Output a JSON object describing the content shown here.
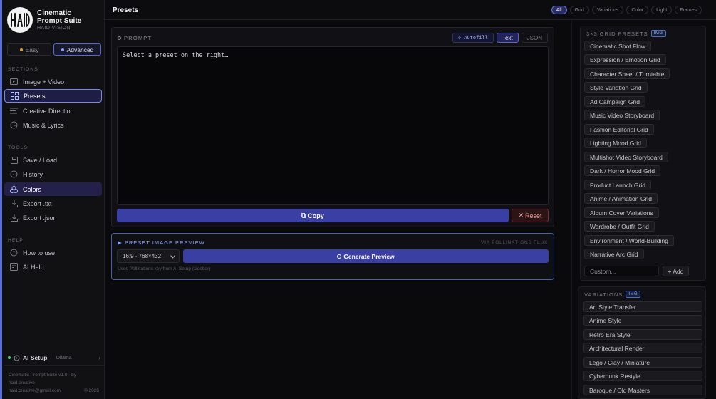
{
  "brand": {
    "title": "Cinematic Prompt Suite",
    "subtitle": "HAID.VISION",
    "logo_text": "HAID"
  },
  "mode": {
    "easy_label": "Easy",
    "advanced_label": "Advanced",
    "selected": "Advanced"
  },
  "sidebar": {
    "sections_label": "SECTIONS",
    "sections": [
      {
        "label": "Image + Video",
        "icon": "image-icon"
      },
      {
        "label": "Presets",
        "icon": "grid-icon"
      },
      {
        "label": "Creative Direction",
        "icon": "lines-icon"
      },
      {
        "label": "Music & Lyrics",
        "icon": "clock-icon"
      }
    ],
    "tools_label": "TOOLS",
    "tools": [
      {
        "label": "Save / Load",
        "icon": "save-icon"
      },
      {
        "label": "History",
        "icon": "history-icon"
      },
      {
        "label": "Colors",
        "icon": "palette-icon"
      },
      {
        "label": "Export .txt",
        "icon": "download-icon"
      },
      {
        "label": "Export .json",
        "icon": "download-icon"
      }
    ],
    "help_label": "HELP",
    "help": [
      {
        "label": "How to use",
        "icon": "question-icon"
      },
      {
        "label": "AI Help",
        "icon": "ai-help-icon"
      }
    ],
    "ai_setup": {
      "label": "AI Setup",
      "provider": "Ollama",
      "chevron": "›"
    },
    "footer": {
      "line1": "Cinematic Prompt Suite v1.0 · by haid.creative",
      "email": "haid.creative@gmail.com",
      "year": "© 2026"
    }
  },
  "header": {
    "title": "Presets",
    "filters": [
      "All",
      "Grid",
      "Variations",
      "Color",
      "Light",
      "Frames"
    ],
    "active_filter": "All"
  },
  "prompt": {
    "label": "PROMPT",
    "autofill_label": "◇ Autofill",
    "tabs": [
      "Text",
      "JSON"
    ],
    "active_tab": "Text",
    "placeholder": "Select a preset on the right…",
    "copy_label": "Copy",
    "reset_label": "Reset"
  },
  "preview": {
    "title": "▶ PRESET IMAGE PREVIEW",
    "via": "VIA POLLINATIONS FLUX",
    "aspect": "16:9 · 768×432",
    "generate_label": "Generate Preview",
    "hint": "Uses Pollinations key from AI Setup (sidebar)"
  },
  "grid_presets": {
    "label": "3×3 GRID PRESETS",
    "badge": "IMG",
    "items": [
      "Cinematic Shot Flow",
      "Expression / Emotion Grid",
      "Character Sheet / Turntable",
      "Style Variation Grid",
      "Ad Campaign Grid",
      "Music Video Storyboard",
      "Fashion Editorial Grid",
      "Lighting Mood Grid",
      "Multishot Video Storyboard",
      "Dark / Horror Mood Grid",
      "Product Launch Grid",
      "Anime / Animation Grid",
      "Album Cover Variations",
      "Wardrobe / Outfit Grid",
      "Environment / World-Building",
      "Narrative Arc Grid"
    ],
    "custom_placeholder": "Custom...",
    "add_label": "+ Add"
  },
  "variations": {
    "label": "VARIATIONS",
    "badge": "IMG",
    "items": [
      "Art Style Transfer",
      "Anime Style",
      "Retro Era Style",
      "Architectural Render",
      "Lego / Clay / Miniature",
      "Cyberpunk Restyle",
      "Baroque / Old Masters"
    ]
  },
  "colors": {
    "accent": "#3a3fa3",
    "active_nav": "#7b88e6",
    "reset": "#7a3036",
    "status_ok": "#4ad17c"
  }
}
